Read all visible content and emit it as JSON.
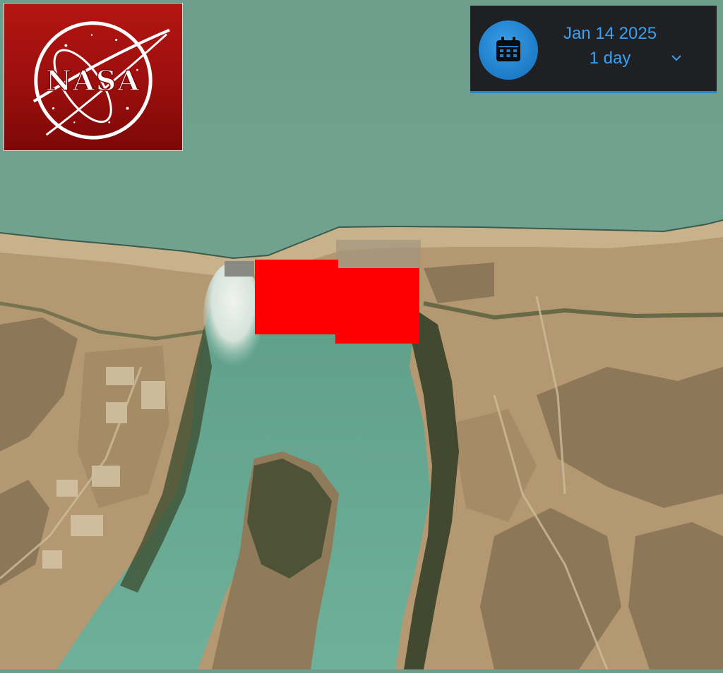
{
  "logo": {
    "text": "NASA",
    "icon": "nasa-meatball-logo"
  },
  "date_selector": {
    "date": "Jan 14 2025",
    "interval": "1 day",
    "calendar_icon": "calendar-icon",
    "dropdown_icon": "chevron-down-icon",
    "accent_color": "#3aa0f0",
    "button_color": "#2180cc",
    "panel_color": "#1f2023"
  },
  "map": {
    "type": "satellite-imagery",
    "redaction_color": "#ff0000"
  }
}
